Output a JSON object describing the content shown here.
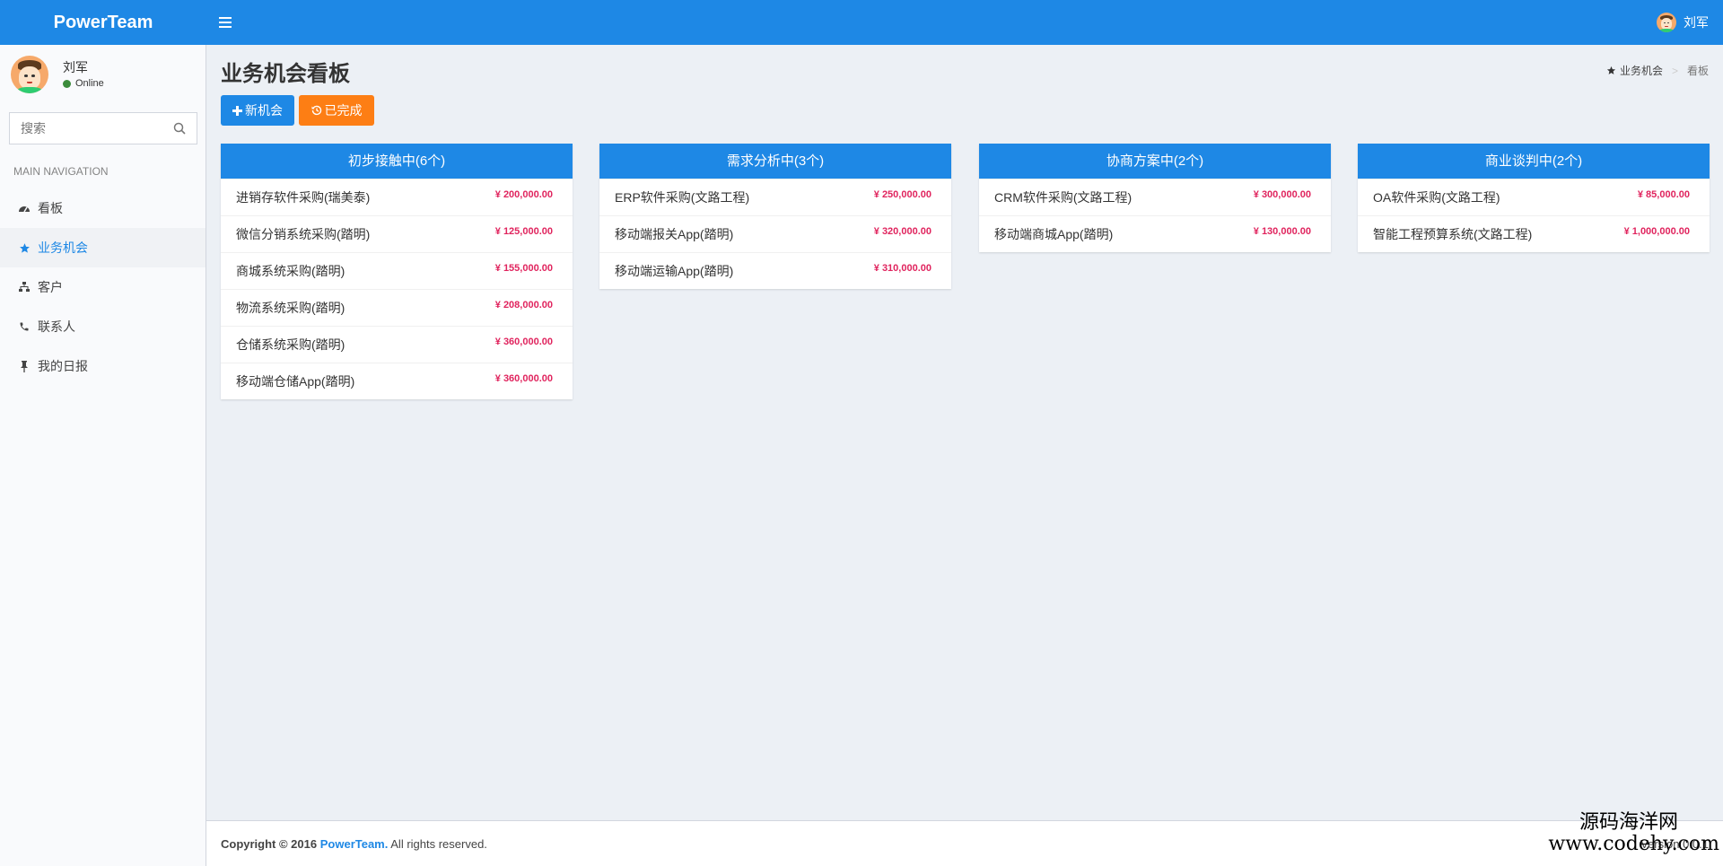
{
  "header": {
    "brand": "PowerTeam",
    "user_name": "刘军"
  },
  "sidebar": {
    "user": {
      "name": "刘军",
      "status": "Online"
    },
    "search_placeholder": "搜索",
    "nav_header": "MAIN NAVIGATION",
    "items": [
      {
        "label": "看板",
        "icon": "dashboard-icon"
      },
      {
        "label": "业务机会",
        "icon": "star-icon",
        "active": true
      },
      {
        "label": "客户",
        "icon": "sitemap-icon"
      },
      {
        "label": "联系人",
        "icon": "phone-icon"
      },
      {
        "label": "我的日报",
        "icon": "pin-icon"
      }
    ]
  },
  "main": {
    "title": "业务机会看板",
    "breadcrumb": {
      "parent": "业务机会",
      "current": "看板"
    },
    "buttons": {
      "new_label": "新机会",
      "done_label": "已完成"
    },
    "boards": [
      {
        "title": "初步接触中(6个)",
        "items": [
          {
            "name": "进销存软件采购(瑞美泰)",
            "amount": "¥ 200,000.00"
          },
          {
            "name": "微信分销系统采购(踏明)",
            "amount": "¥ 125,000.00"
          },
          {
            "name": "商城系统采购(踏明)",
            "amount": "¥ 155,000.00"
          },
          {
            "name": "物流系统采购(踏明)",
            "amount": "¥ 208,000.00"
          },
          {
            "name": "仓储系统采购(踏明)",
            "amount": "¥ 360,000.00"
          },
          {
            "name": "移动端仓储App(踏明)",
            "amount": "¥ 360,000.00"
          }
        ]
      },
      {
        "title": "需求分析中(3个)",
        "items": [
          {
            "name": "ERP软件采购(文路工程)",
            "amount": "¥ 250,000.00"
          },
          {
            "name": "移动端报关App(踏明)",
            "amount": "¥ 320,000.00"
          },
          {
            "name": "移动端运输App(踏明)",
            "amount": "¥ 310,000.00"
          }
        ]
      },
      {
        "title": "协商方案中(2个)",
        "items": [
          {
            "name": "CRM软件采购(文路工程)",
            "amount": "¥ 300,000.00"
          },
          {
            "name": "移动端商城App(踏明)",
            "amount": "¥ 130,000.00"
          }
        ]
      },
      {
        "title": "商业谈判中(2个)",
        "items": [
          {
            "name": "OA软件采购(文路工程)",
            "amount": "¥ 85,000.00"
          },
          {
            "name": "智能工程预算系统(文路工程)",
            "amount": "¥ 1,000,000.00"
          }
        ]
      }
    ]
  },
  "footer": {
    "copyright_prefix": "Copyright © 2016",
    "brand": "PowerTeam.",
    "rights": "All rights reserved.",
    "version": "Version 0.0.1"
  },
  "watermark": {
    "line1": "源码海洋网",
    "line2": "www.codehy.com"
  },
  "colors": {
    "primary": "#1e88e5",
    "warning": "#fd7e14",
    "amount": "#e0245e",
    "background": "#ecf0f5"
  }
}
